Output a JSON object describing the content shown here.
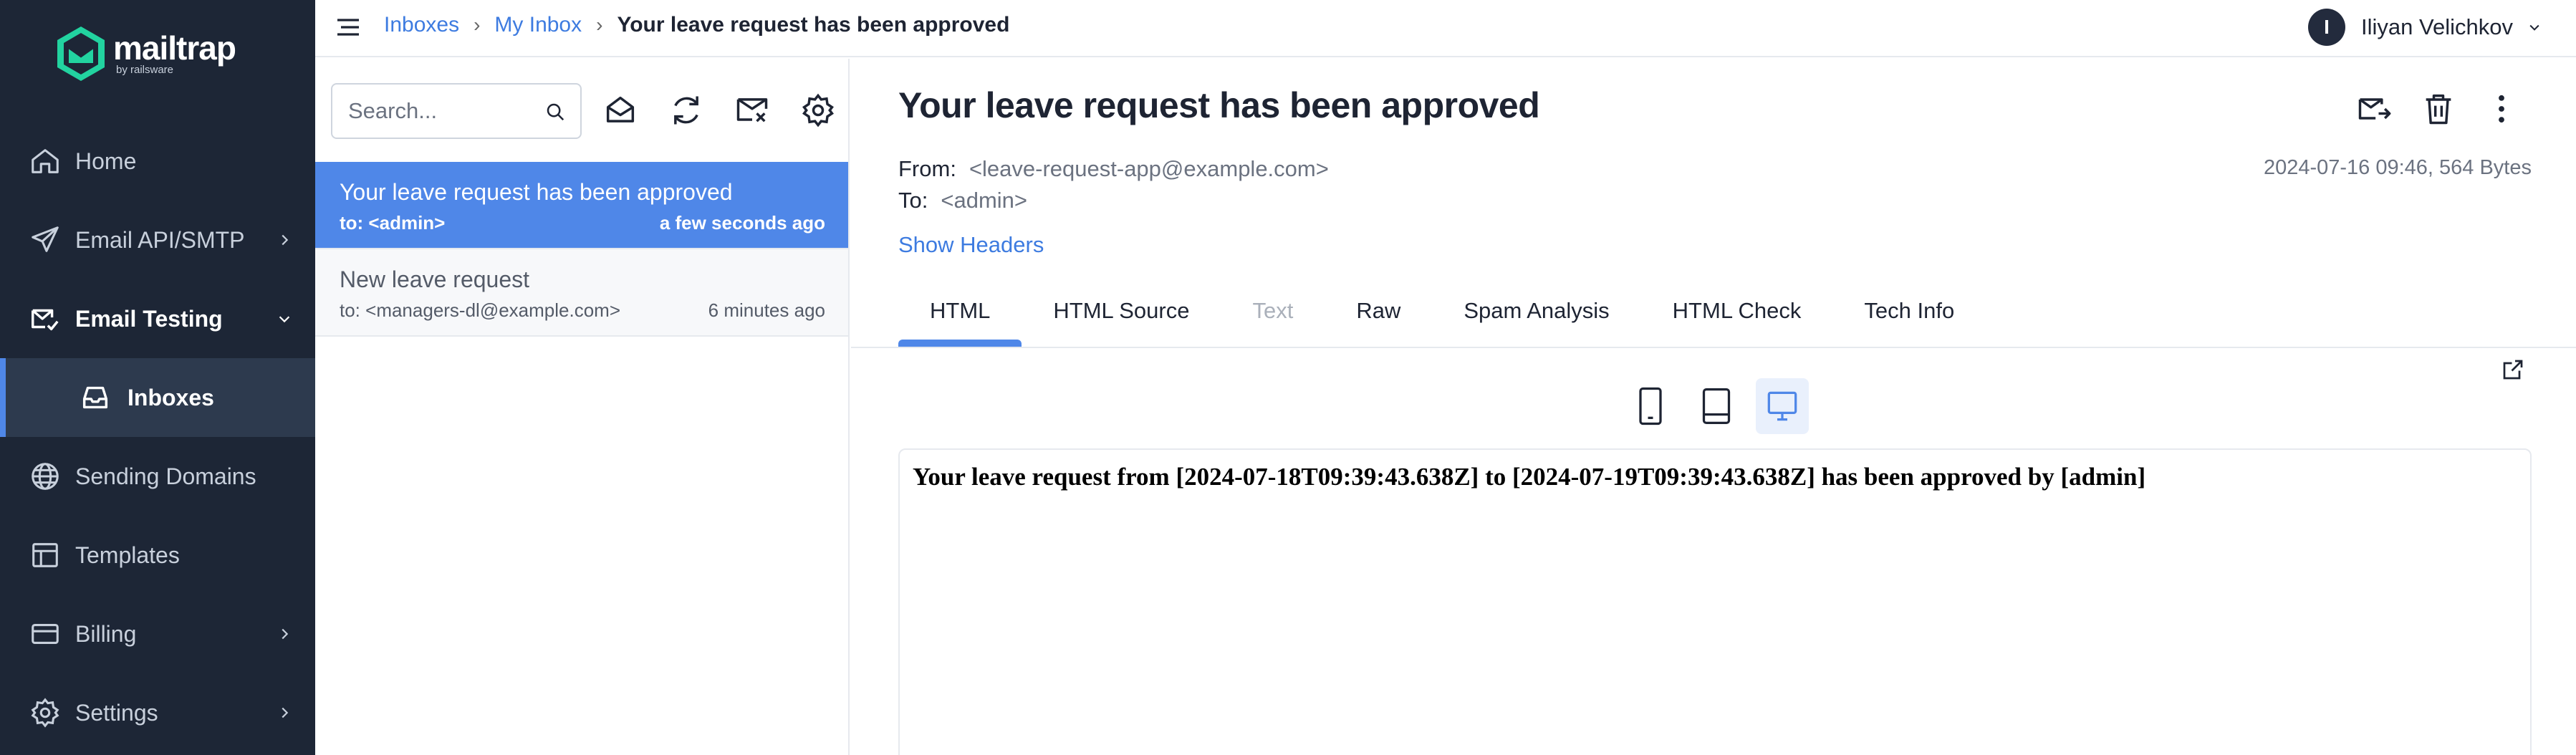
{
  "brand": {
    "name": "mailtrap",
    "by": "by railsware",
    "accent": "#4f87e8",
    "sidebar_bg": "#1d2636"
  },
  "sidebar": {
    "items": [
      {
        "label": "Home",
        "icon": "home-icon"
      },
      {
        "label": "Email API/SMTP",
        "icon": "send-icon"
      },
      {
        "label": "Email Testing",
        "icon": "email-testing-icon"
      },
      {
        "label": "Inboxes",
        "icon": "inbox-icon"
      },
      {
        "label": "Sending Domains",
        "icon": "globe-icon"
      },
      {
        "label": "Templates",
        "icon": "template-icon"
      },
      {
        "label": "Billing",
        "icon": "credit-card-icon"
      },
      {
        "label": "Settings",
        "icon": "gear-icon"
      }
    ]
  },
  "breadcrumb": {
    "items": [
      "Inboxes",
      "My Inbox"
    ],
    "separator": "›",
    "current": "Your leave request has been approved"
  },
  "user": {
    "initial": "I",
    "name": "Iliyan Velichkov"
  },
  "search": {
    "placeholder": "Search..."
  },
  "messages": [
    {
      "subject": "Your leave request has been approved",
      "to": "to: <admin>",
      "time": "a few seconds ago",
      "selected": true
    },
    {
      "subject": "New leave request",
      "to": "to: <managers-dl@example.com>",
      "time": "6 minutes ago",
      "selected": false
    }
  ],
  "message": {
    "subject": "Your leave request has been approved",
    "from_label": "From:",
    "from": "<leave-request-app@example.com>",
    "to_label": "To:",
    "to": "<admin>",
    "meta": "2024-07-16 09:46, 564 Bytes",
    "show_headers": "Show Headers",
    "tabs": [
      "HTML",
      "HTML Source",
      "Text",
      "Raw",
      "Spam Analysis",
      "HTML Check",
      "Tech Info"
    ],
    "body": "Your leave request from [2024-07-18T09:39:43.638Z] to [2024-07-19T09:39:43.638Z] has been approved by [admin]"
  }
}
